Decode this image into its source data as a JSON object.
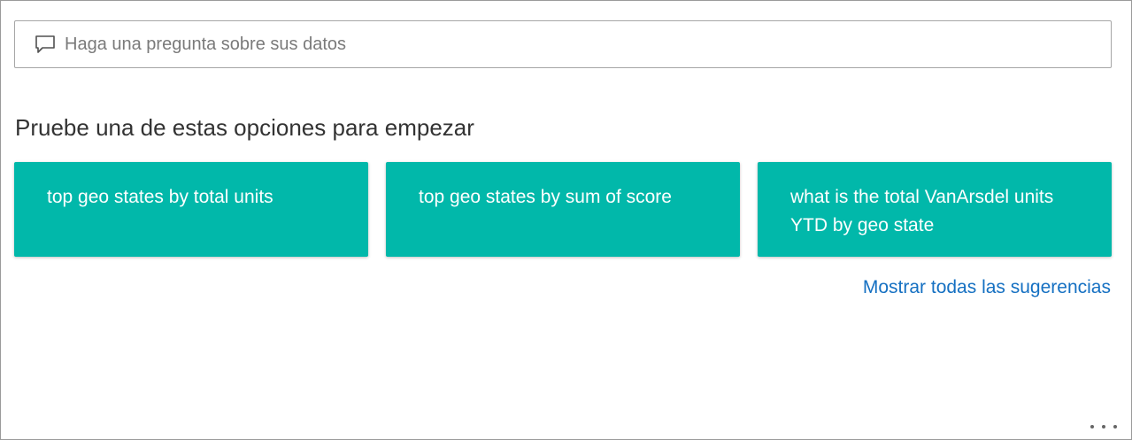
{
  "qa": {
    "icon": "chat-bubble-icon",
    "placeholder": "Haga una pregunta sobre sus datos",
    "value": ""
  },
  "suggestions": {
    "heading": "Pruebe una de estas opciones para empezar",
    "items": [
      {
        "label": "top geo states by total units"
      },
      {
        "label": "top geo states by sum of score"
      },
      {
        "label": "what is the total VanArsdel units YTD by geo state"
      }
    ],
    "show_all_label": "Mostrar todas las sugerencias"
  },
  "more_menu": {
    "icon": "more-options-icon"
  },
  "colors": {
    "card_background": "#01b8aa",
    "link": "#1570c2",
    "border": "#a6a6a6"
  }
}
